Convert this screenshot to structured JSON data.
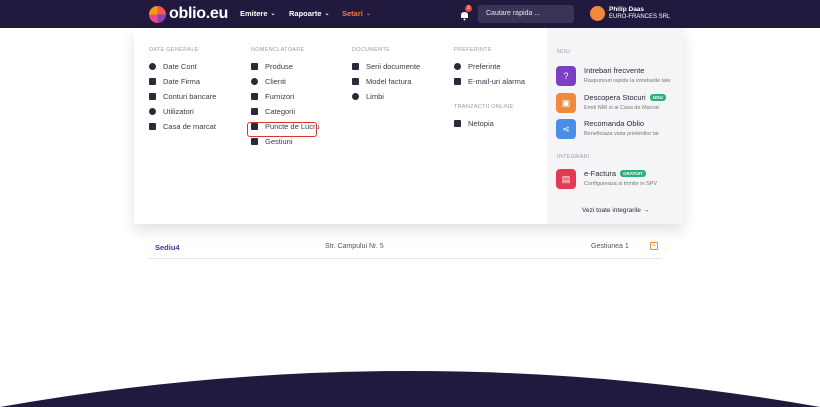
{
  "topbar": {
    "logo_text": "oblio.eu",
    "nav": [
      {
        "label": "Emitere"
      },
      {
        "label": "Rapoarte"
      },
      {
        "label": "Setari"
      }
    ],
    "notification_count": "2",
    "search_placeholder": "Cautare rapida ...",
    "user_name": "Philip Daas",
    "user_company": "EURO-FRANCES SRL"
  },
  "menu": {
    "columns": [
      {
        "title": "DATE GENERALE",
        "items": [
          {
            "label": "Date Cont",
            "icon": "user-icon"
          },
          {
            "label": "Date Firma",
            "icon": "building-icon"
          },
          {
            "label": "Conturi bancare",
            "icon": "bank-icon"
          },
          {
            "label": "Utilizatori",
            "icon": "users-icon"
          },
          {
            "label": "Casa de marcat",
            "icon": "cash-register-icon"
          }
        ]
      },
      {
        "title": "NOMENCLATOARE",
        "items": [
          {
            "label": "Produse",
            "icon": "box-icon"
          },
          {
            "label": "Clienti",
            "icon": "person-icon"
          },
          {
            "label": "Furnizori",
            "icon": "truck-icon"
          },
          {
            "label": "Categorii",
            "icon": "list-icon"
          },
          {
            "label": "Puncte de Lucru",
            "icon": "store-icon"
          },
          {
            "label": "Gestiuni",
            "icon": "layers-icon"
          }
        ]
      },
      {
        "title": "DOCUMENTE",
        "items": [
          {
            "label": "Serii documente",
            "icon": "hash-icon"
          },
          {
            "label": "Model factura",
            "icon": "document-icon"
          },
          {
            "label": "Limbi",
            "icon": "globe-icon"
          }
        ]
      },
      {
        "title": "PREFERINTE",
        "items": [
          {
            "label": "Preferinte",
            "icon": "gear-icon"
          },
          {
            "label": "E-mail-uri alarma",
            "icon": "mail-icon"
          }
        ]
      }
    ],
    "online_title": "TRANZACTII ONLINE",
    "online_items": [
      {
        "label": "Netopia",
        "icon": "card-icon"
      }
    ],
    "nou_title": "NOU",
    "features": [
      {
        "title": "Intrebari frecvente",
        "subtitle": "Raspunsuri rapide la intrebarile tale",
        "color": "#7b3fc4",
        "icon": "question-icon"
      },
      {
        "title": "Descopera Stocuri",
        "subtitle": "Emiti NIR si ai Casa de Marcat",
        "color": "#f08a3a",
        "tag": "NOU",
        "tag_color": "#2ab27b",
        "icon": "box-icon"
      },
      {
        "title": "Recomanda Oblio",
        "subtitle": "Beneficiaza viata prietenilor tai",
        "color": "#4a8ee8",
        "icon": "share-icon"
      }
    ],
    "integrari_title": "INTEGRARI",
    "integrations": [
      {
        "title": "e-Factura",
        "subtitle": "Configureaza si trimite in SPV",
        "color": "#e23a52",
        "tag": "GRATUIT",
        "tag_color": "#2ab27b",
        "icon": "invoice-icon"
      }
    ],
    "integrations_link": "Vezi toate integrarile"
  },
  "table": {
    "rows": [
      {
        "name": "Sediu4",
        "address": "Str. Campului Nr. 5",
        "gestiune": "Gestiunea 1"
      }
    ]
  },
  "colors": {
    "topbar": "#22193f",
    "accent": "#f0784a",
    "highlight": "#d9342b"
  }
}
